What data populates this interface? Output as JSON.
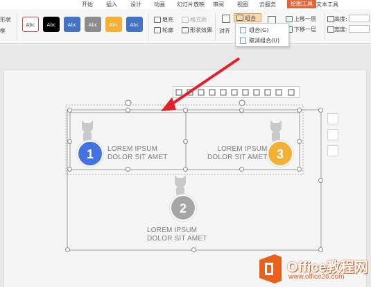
{
  "menu": {
    "tabs": [
      "开始",
      "插入",
      "设计",
      "动画",
      "幻灯片放映",
      "审阅",
      "视图",
      "云服务",
      "绘图工具",
      "文本工具"
    ],
    "active": "绘图工具"
  },
  "ribbon": {
    "left_labels": [
      "形状",
      "框"
    ],
    "styles": [
      {
        "label": "Abc",
        "bg": "#ffffff",
        "color": "#333333",
        "border": "#e04040"
      },
      {
        "label": "Abc",
        "bg": "#000000",
        "color": "#ffffff",
        "border": "#000000"
      },
      {
        "label": "Abc",
        "bg": "#4472c4",
        "color": "#ffffff",
        "border": "#4472c4"
      },
      {
        "label": "Abc",
        "bg": "#8c8c8c",
        "color": "#ffffff",
        "border": "#8c8c8c"
      },
      {
        "label": "Abc",
        "bg": "#f2b035",
        "color": "#ffffff",
        "border": "#f2b035"
      },
      {
        "label": "Abc",
        "bg": "#4472c4",
        "color": "#ffffff",
        "border": "#4472c4"
      }
    ],
    "fill": "填充",
    "format_painter": "格式刷",
    "outline": "轮廓",
    "shape_effects": "形状效果",
    "align": "对齐",
    "group": "组合",
    "bring_forward": "上移一层",
    "send_backward": "下移一层",
    "height": "高度:",
    "width": "宽度:"
  },
  "dropdown": {
    "items": [
      "组合(G)",
      "取消组合(U)"
    ]
  },
  "slide": {
    "items": [
      {
        "number": "1",
        "color": "#4472e0",
        "line1": "LOREM IPSUM",
        "line2": "DOLOR SIT AMET"
      },
      {
        "number": "2",
        "color": "#a6a6a6",
        "line1": "LOREM IPSUM",
        "line2": "DOLOR SIT AMET"
      },
      {
        "number": "3",
        "color": "#f2b035",
        "line1": "LOREM IPSUM",
        "line2": "DOLOR SIT AMET"
      }
    ]
  },
  "watermark": {
    "brand": "Office教程网",
    "url": "www.office26.com"
  },
  "colors": {
    "accent": "#e0653c",
    "arrow": "#e0202a"
  }
}
